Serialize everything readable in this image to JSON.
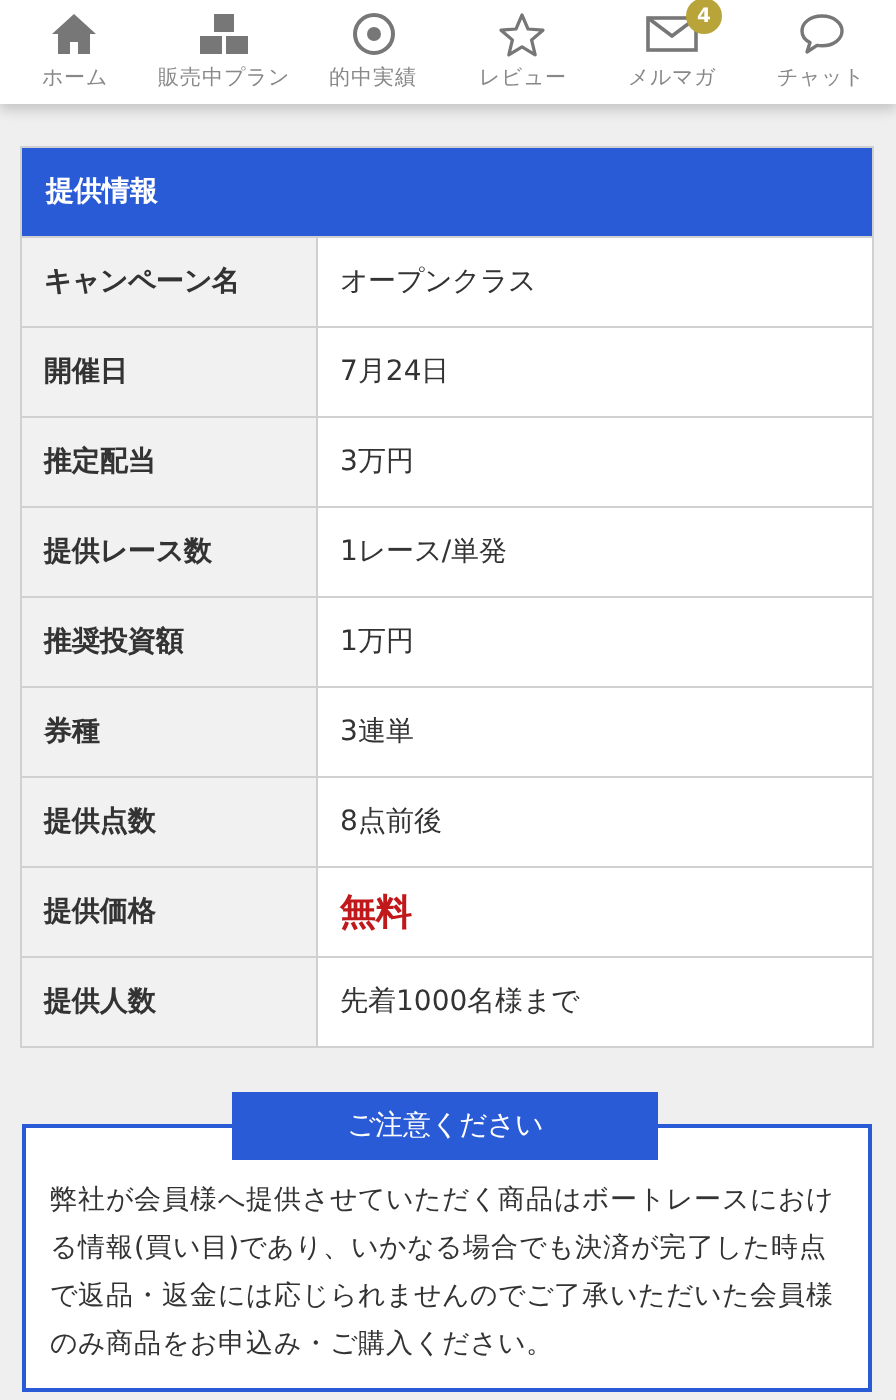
{
  "nav": [
    {
      "label": "ホーム"
    },
    {
      "label": "販売中プラン"
    },
    {
      "label": "的中実績"
    },
    {
      "label": "レビュー"
    },
    {
      "label": "メルマガ",
      "badge": "4"
    },
    {
      "label": "チャット"
    }
  ],
  "info": {
    "title": "提供情報",
    "rows": [
      {
        "label": "キャンペーン名",
        "value": "オープンクラス",
        "emphasis": false
      },
      {
        "label": "開催日",
        "value": "7月24日",
        "emphasis": false
      },
      {
        "label": "推定配当",
        "value": "3万円",
        "emphasis": false
      },
      {
        "label": "提供レース数",
        "value": "1レース/単発",
        "emphasis": false
      },
      {
        "label": "推奨投資額",
        "value": "1万円",
        "emphasis": false
      },
      {
        "label": "券種",
        "value": "3連単",
        "emphasis": false
      },
      {
        "label": "提供点数",
        "value": "8点前後",
        "emphasis": false
      },
      {
        "label": "提供価格",
        "value": "無料",
        "emphasis": true
      },
      {
        "label": "提供人数",
        "value": "先着1000名様まで",
        "emphasis": false
      }
    ]
  },
  "notice": {
    "title": "ご注意ください",
    "text": "弊社が会員様へ提供させていただく商品はボートレースにおける情報(買い目)であり、いかなる場合でも決済が完了した時点で返品・返金には応じられませんのでご了承いただいた会員様のみ商品をお申込み・ご購入ください。"
  }
}
